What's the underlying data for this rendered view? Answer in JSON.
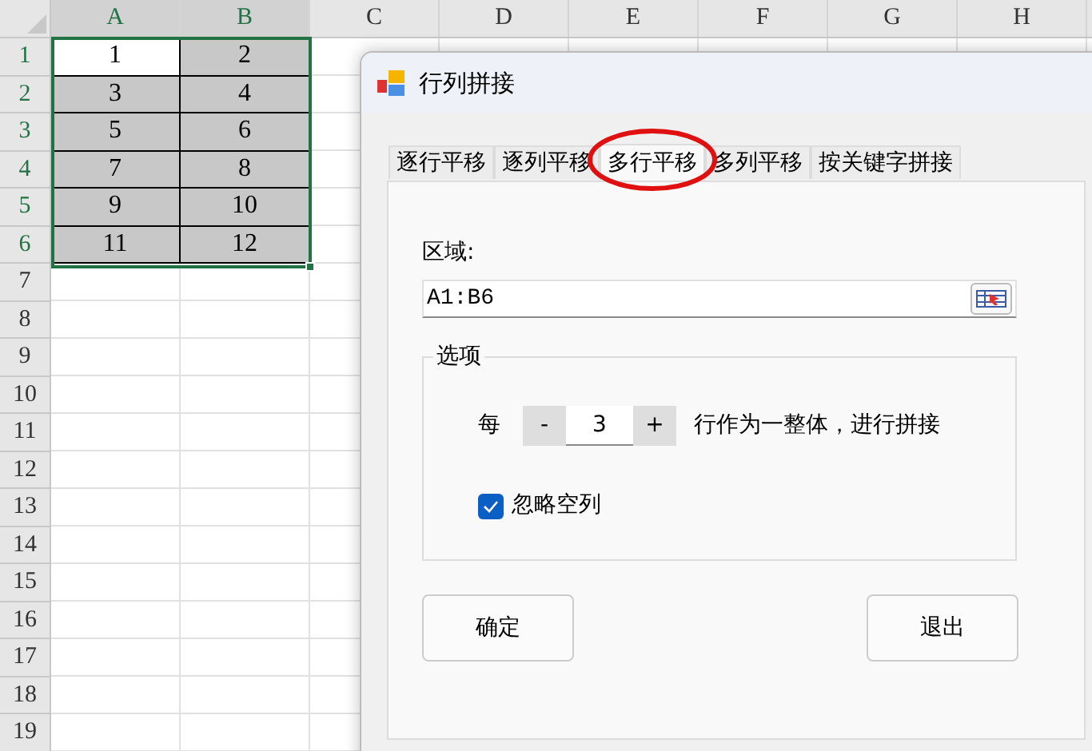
{
  "sheet": {
    "columns": [
      "A",
      "B",
      "C",
      "D",
      "E",
      "F",
      "G",
      "H"
    ],
    "rows": [
      {
        "header": "1",
        "cells": [
          {
            "text": "1",
            "active": true
          },
          {
            "text": "2",
            "active": false
          }
        ]
      },
      {
        "header": "2",
        "cells": [
          {
            "text": "3",
            "active": false
          },
          {
            "text": "4",
            "active": false
          }
        ]
      },
      {
        "header": "3",
        "cells": [
          {
            "text": "5",
            "active": false
          },
          {
            "text": "6",
            "active": false
          }
        ]
      },
      {
        "header": "4",
        "cells": [
          {
            "text": "7",
            "active": false
          },
          {
            "text": "8",
            "active": false
          }
        ]
      },
      {
        "header": "5",
        "cells": [
          {
            "text": "9",
            "active": false
          },
          {
            "text": "10",
            "active": false
          }
        ]
      },
      {
        "header": "6",
        "cells": [
          {
            "text": "11",
            "active": false
          },
          {
            "text": "12",
            "active": false
          }
        ]
      },
      {
        "header": "7",
        "cells": []
      },
      {
        "header": "8",
        "cells": []
      },
      {
        "header": "9",
        "cells": []
      },
      {
        "header": "10",
        "cells": []
      },
      {
        "header": "11",
        "cells": []
      },
      {
        "header": "12",
        "cells": []
      },
      {
        "header": "13",
        "cells": []
      },
      {
        "header": "14",
        "cells": []
      },
      {
        "header": "15",
        "cells": []
      },
      {
        "header": "16",
        "cells": []
      },
      {
        "header": "17",
        "cells": []
      },
      {
        "header": "18",
        "cells": []
      },
      {
        "header": "19",
        "cells": []
      }
    ]
  },
  "dialog": {
    "title": "行列拼接",
    "tabs": [
      {
        "label": "逐行平移",
        "selected": false,
        "circled": false
      },
      {
        "label": "逐列平移",
        "selected": false,
        "circled": false
      },
      {
        "label": "多行平移",
        "selected": true,
        "circled": true
      },
      {
        "label": "多列平移",
        "selected": false,
        "circled": false
      },
      {
        "label": "按关键字拼接",
        "selected": false,
        "circled": false
      }
    ],
    "range": {
      "label": "区域:",
      "value": "A1:B6"
    },
    "options": {
      "title": "选项",
      "prefix": "每",
      "decrement": "-",
      "value": "3",
      "increment": "+",
      "suffix": "行作为一整体，进行拼接",
      "checkbox": {
        "label": "忽略空列",
        "checked": true
      }
    },
    "buttons": [
      "确定",
      "退出"
    ]
  }
}
